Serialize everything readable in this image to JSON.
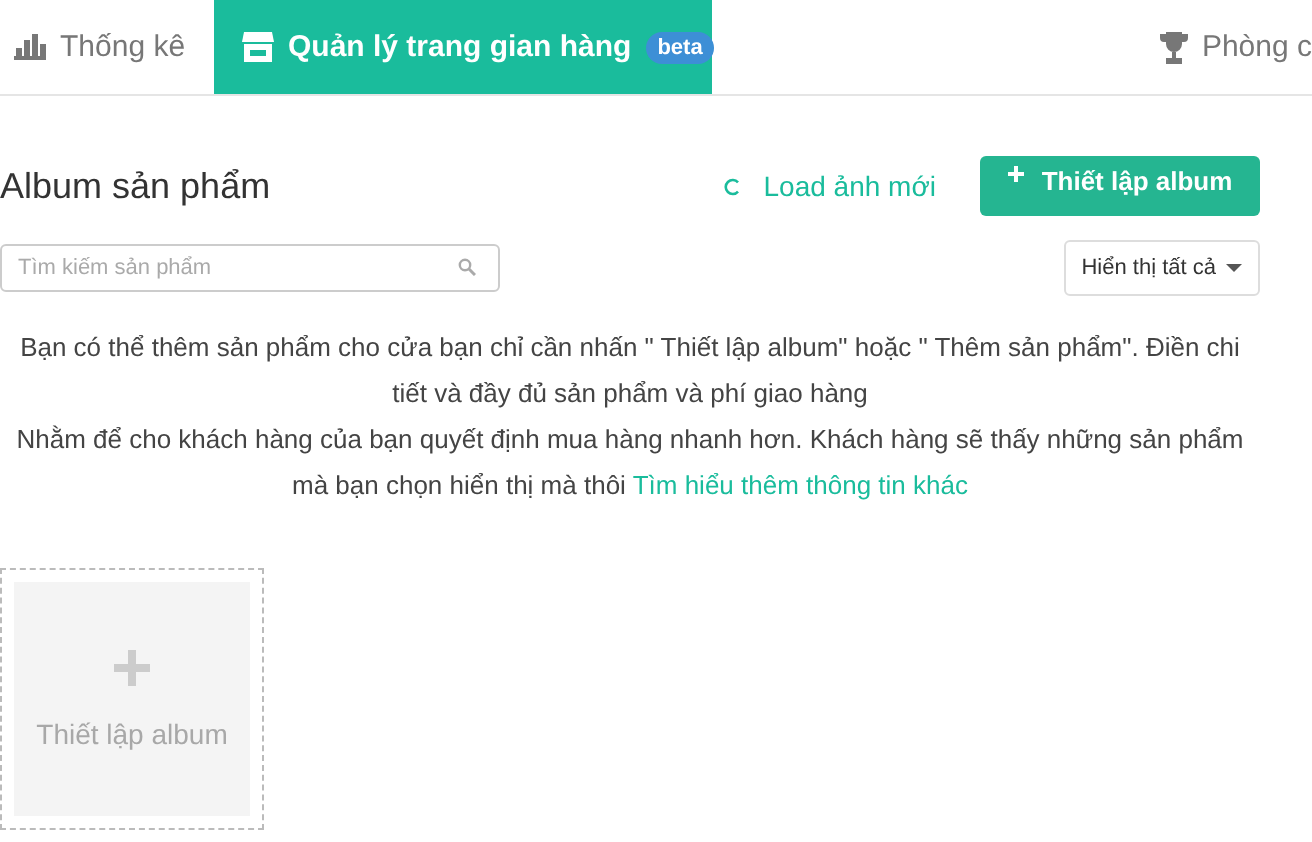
{
  "tabs": [
    {
      "label": "Thống kê",
      "selected": false
    },
    {
      "label": "Quản lý trang gian hàng",
      "badge": "beta",
      "selected": true
    },
    {
      "label": "Phòng c",
      "selected": false
    }
  ],
  "header": {
    "title": "Album sản phẩm",
    "reload_link": "Load ảnh mới",
    "create_button": "Thiết lập album"
  },
  "search": {
    "placeholder": "Tìm kiếm sản phẩm"
  },
  "filter": {
    "value": "Hiển thị tất cả"
  },
  "intro": {
    "line_1": "Bạn có thể thêm sản phẩm cho cửa bạn chỉ cần nhấn \" Thiết lập album\" hoặc \" Thêm sản phẩm\". Điền chi tiết và đầy đủ sản phẩm và phí giao hàng",
    "line_2": "Nhằm để cho khách hàng của bạn quyết định mua hàng nhanh hơn. Khách hàng sẽ thấy những sản phẩm mà bạn chọn hiển thị mà thôi",
    "link": "Tìm hiểu thêm thông tin khác"
  },
  "albums": [
    {
      "kind": "add",
      "label": "Thiết lập album"
    }
  ]
}
